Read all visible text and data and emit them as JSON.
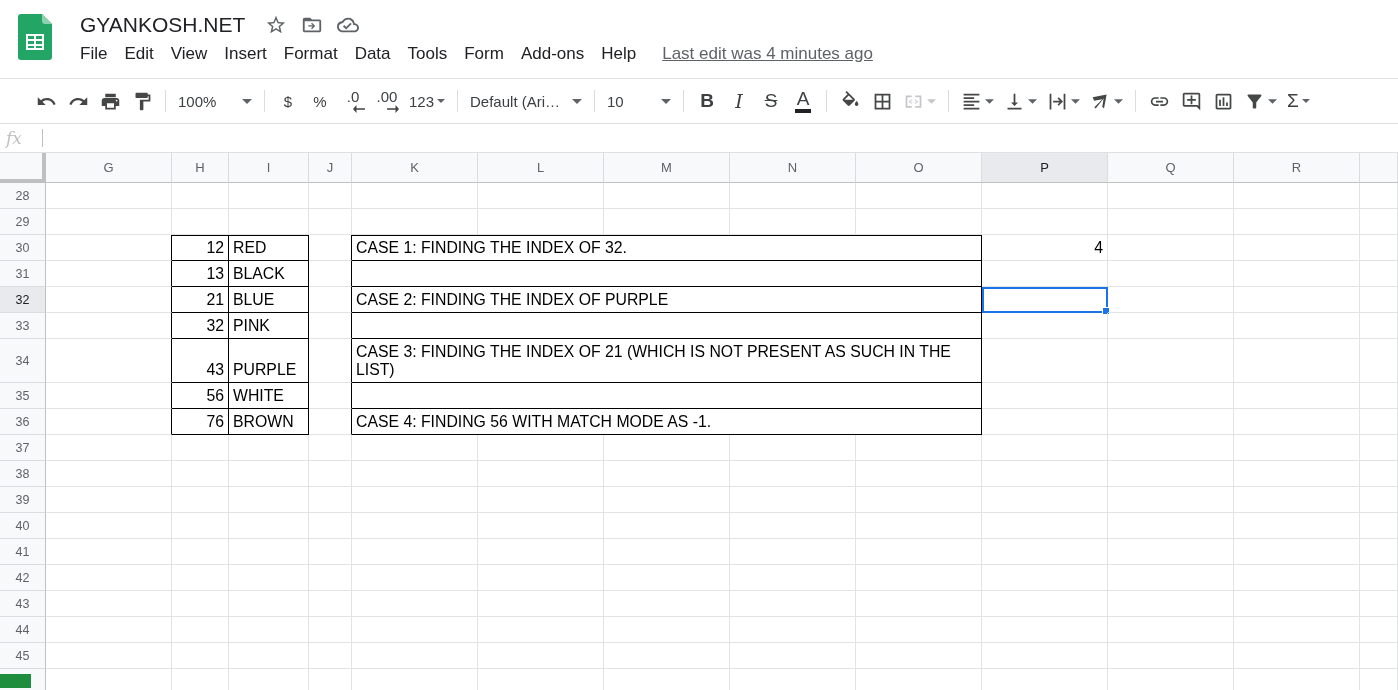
{
  "header": {
    "title": "GYANKOSH.NET",
    "menus": [
      "File",
      "Edit",
      "View",
      "Insert",
      "Format",
      "Data",
      "Tools",
      "Form",
      "Add-ons",
      "Help"
    ],
    "last_edit": "Last edit was 4 minutes ago"
  },
  "toolbar": [
    {
      "kind": "undo",
      "disabled": false
    },
    {
      "kind": "redo",
      "disabled": false
    },
    {
      "kind": "print",
      "disabled": false
    },
    {
      "kind": "paint-format",
      "disabled": false
    },
    {
      "kind": "separator"
    },
    {
      "kind": "zoom",
      "label": "100%",
      "disabled": false
    },
    {
      "kind": "separator"
    },
    {
      "kind": "currency",
      "label": "$",
      "disabled": false
    },
    {
      "kind": "percent",
      "label": "%",
      "disabled": false
    },
    {
      "kind": "decimal-decrease",
      "label": ".0",
      "disabled": false
    },
    {
      "kind": "decimal-increase",
      "label": ".00",
      "disabled": false
    },
    {
      "kind": "number-format",
      "label": "123",
      "disabled": false
    },
    {
      "kind": "separator"
    },
    {
      "kind": "font",
      "label": "Default (Ari…",
      "disabled": false
    },
    {
      "kind": "separator"
    },
    {
      "kind": "font-size",
      "label": "10",
      "disabled": false
    },
    {
      "kind": "separator"
    },
    {
      "kind": "bold",
      "label": "B",
      "disabled": false
    },
    {
      "kind": "italic",
      "label": "I",
      "disabled": false
    },
    {
      "kind": "strikethrough",
      "label": "S",
      "disabled": false
    },
    {
      "kind": "text-color",
      "label": "A",
      "disabled": false
    },
    {
      "kind": "separator"
    },
    {
      "kind": "fill-color",
      "disabled": false
    },
    {
      "kind": "borders",
      "disabled": false
    },
    {
      "kind": "merge",
      "disabled": true
    },
    {
      "kind": "separator"
    },
    {
      "kind": "align",
      "disabled": false
    },
    {
      "kind": "vertical-align",
      "disabled": false
    },
    {
      "kind": "wrap",
      "disabled": false
    },
    {
      "kind": "rotate",
      "disabled": false
    },
    {
      "kind": "separator"
    },
    {
      "kind": "link",
      "disabled": false
    },
    {
      "kind": "comment",
      "disabled": false
    },
    {
      "kind": "chart",
      "disabled": false
    },
    {
      "kind": "filter",
      "disabled": false
    },
    {
      "kind": "functions",
      "label": "Σ",
      "disabled": false
    }
  ],
  "formula_bar": {
    "label": "fx"
  },
  "sheet": {
    "columns": [
      {
        "label": "G",
        "selected": false
      },
      {
        "label": "H",
        "selected": false
      },
      {
        "label": "I",
        "selected": false
      },
      {
        "label": "J",
        "selected": false
      },
      {
        "label": "K",
        "selected": false
      },
      {
        "label": "L",
        "selected": false
      },
      {
        "label": "M",
        "selected": false
      },
      {
        "label": "N",
        "selected": false
      },
      {
        "label": "O",
        "selected": false
      },
      {
        "label": "P",
        "selected": true
      },
      {
        "label": "Q",
        "selected": false
      },
      {
        "label": "R",
        "selected": false
      }
    ],
    "rows": [
      {
        "number": "28",
        "selected": false,
        "bordered": false
      },
      {
        "number": "29",
        "selected": false,
        "bordered": false
      },
      {
        "number": "30",
        "selected": false,
        "bordered": true,
        "h": "12",
        "i": "RED",
        "case": "CASE 1: FINDING THE INDEX OF 32.",
        "p": "4"
      },
      {
        "number": "31",
        "selected": false,
        "bordered": true,
        "h": "13",
        "i": "BLACK"
      },
      {
        "number": "32",
        "selected": true,
        "bordered": true,
        "h": "21",
        "i": "BLUE",
        "case": "CASE 2: FINDING THE INDEX OF PURPLE"
      },
      {
        "number": "33",
        "selected": false,
        "bordered": true,
        "h": "32",
        "i": "PINK"
      },
      {
        "number": "34",
        "selected": false,
        "bordered": true,
        "h": "43",
        "i": "PURPLE",
        "case": "CASE 3: FINDING THE INDEX OF 21 (WHICH IS NOT PRESENT AS SUCH IN THE LIST)"
      },
      {
        "number": "35",
        "selected": false,
        "bordered": true,
        "h": "56",
        "i": "WHITE"
      },
      {
        "number": "36",
        "selected": false,
        "bordered": true,
        "h": "76",
        "i": "BROWN",
        "case": "CASE 4: FINDING 56 WITH MATCH MODE AS -1."
      },
      {
        "number": "37",
        "selected": false,
        "bordered": false
      },
      {
        "number": "38",
        "selected": false,
        "bordered": false
      },
      {
        "number": "39",
        "selected": false,
        "bordered": false
      },
      {
        "number": "40",
        "selected": false,
        "bordered": false
      },
      {
        "number": "41",
        "selected": false,
        "bordered": false
      },
      {
        "number": "42",
        "selected": false,
        "bordered": false
      },
      {
        "number": "43",
        "selected": false,
        "bordered": false
      },
      {
        "number": "44",
        "selected": false,
        "bordered": false
      },
      {
        "number": "45",
        "selected": false,
        "bordered": false
      }
    ]
  }
}
